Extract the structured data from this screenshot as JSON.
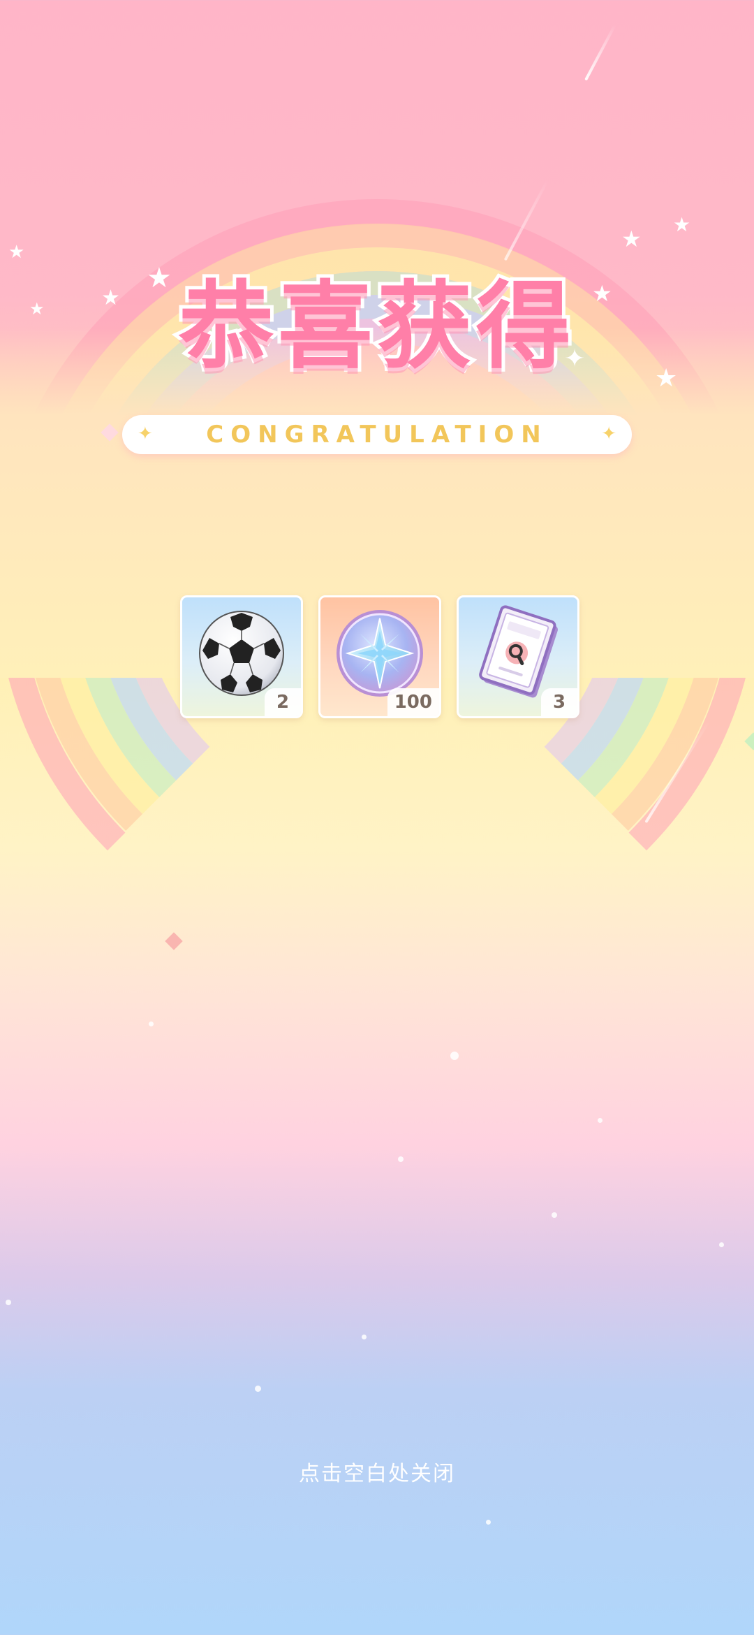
{
  "title": "恭喜获得",
  "subtitle": "CONGRATULATION",
  "rewards": [
    {
      "item": "soccer-ball",
      "count": "2"
    },
    {
      "item": "star-coin",
      "count": "100"
    },
    {
      "item": "detective-book",
      "count": "3"
    }
  ],
  "close_hint": "点击空白处关闭",
  "colors": {
    "title_fill": "#ff7fa8",
    "subtitle_text": "#f2c65a",
    "badge_text": "#7a6a60"
  }
}
